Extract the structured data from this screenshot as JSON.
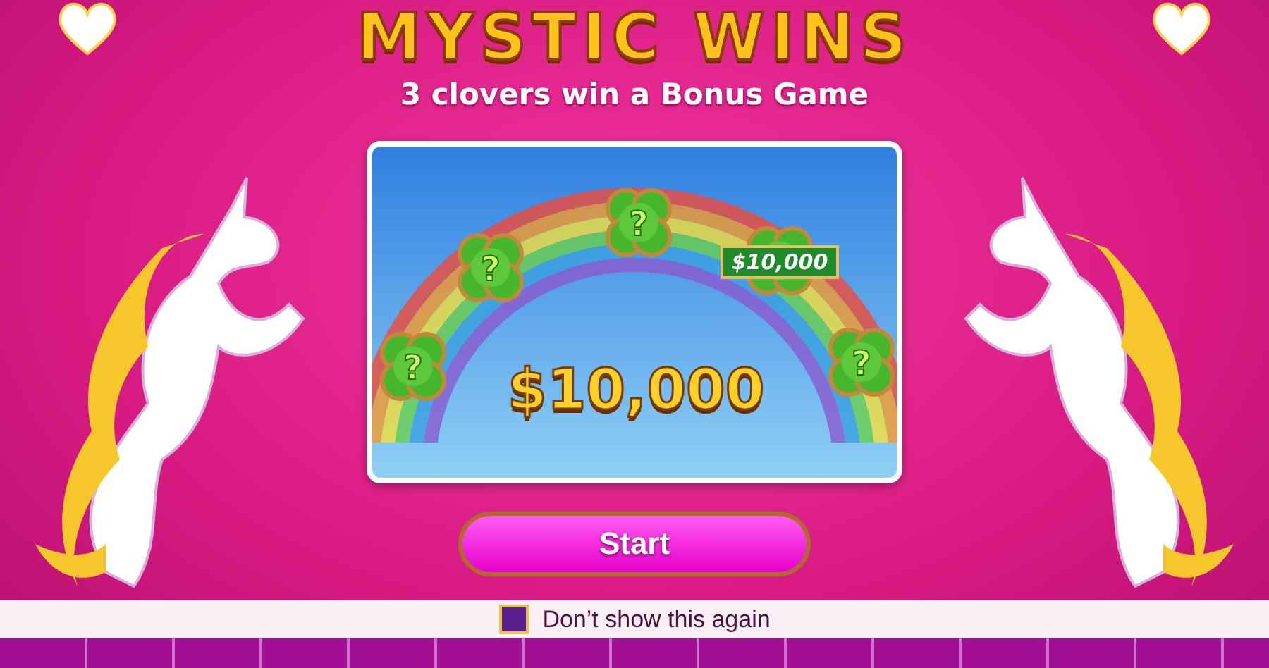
{
  "title": "MYSTIC WINS",
  "subtitle": "3 clovers win a Bonus Game",
  "board": {
    "prize": "$10,000",
    "clovers": [
      {
        "kind": "hidden",
        "label": "?"
      },
      {
        "kind": "hidden",
        "label": "?"
      },
      {
        "kind": "hidden",
        "label": "?"
      },
      {
        "kind": "revealed",
        "label": "$10,000"
      },
      {
        "kind": "hidden",
        "label": "?"
      }
    ]
  },
  "start_button": "Start",
  "dont_show": {
    "label": "Don’t show this again",
    "checked": false
  }
}
